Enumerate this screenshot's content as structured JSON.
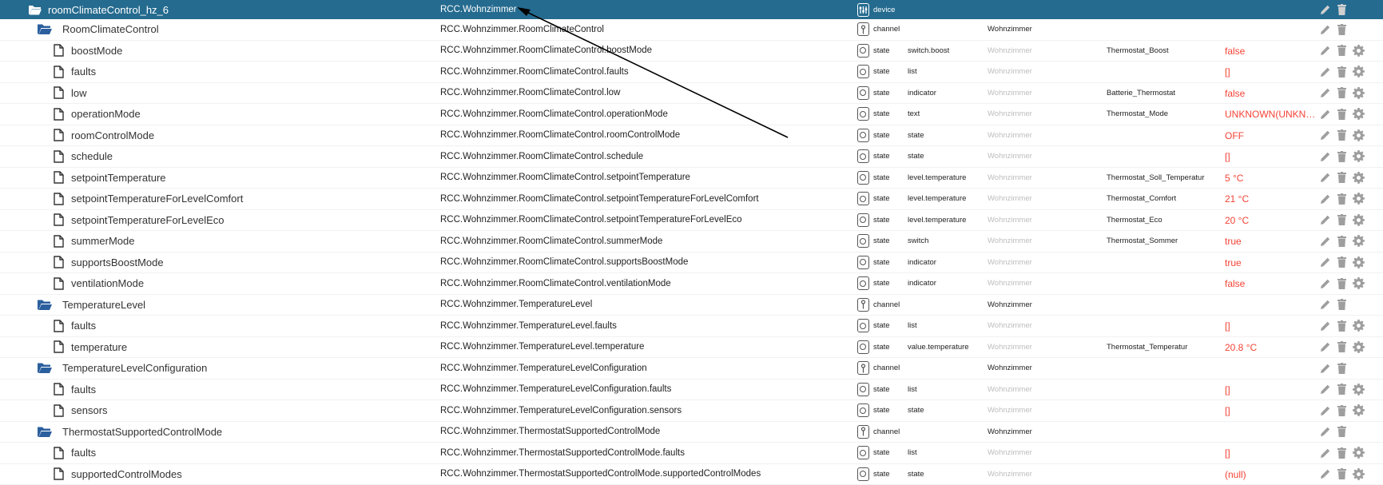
{
  "header": {
    "name": "roomClimateControl_hz_6",
    "id": "RCC.Wohnzimmer",
    "type": "device"
  },
  "rows": [
    {
      "kind": "channel",
      "name": "RoomClimateControl",
      "id": "RCC.Wohnzimmer.RoomClimateControl",
      "type": "channel",
      "role": "",
      "room": "Wohnzimmer",
      "func": "",
      "value": ""
    },
    {
      "kind": "state",
      "name": "boostMode",
      "id": "RCC.Wohnzimmer.RoomClimateControl.boostMode",
      "type": "state",
      "role": "switch.boost",
      "room": "Wohnzimmer",
      "func": "Thermostat_Boost",
      "value": "false"
    },
    {
      "kind": "state",
      "name": "faults",
      "id": "RCC.Wohnzimmer.RoomClimateControl.faults",
      "type": "state",
      "role": "list",
      "room": "Wohnzimmer",
      "func": "",
      "value": "[]"
    },
    {
      "kind": "state",
      "name": "low",
      "id": "RCC.Wohnzimmer.RoomClimateControl.low",
      "type": "state",
      "role": "indicator",
      "room": "Wohnzimmer",
      "func": "Batterie_Thermostat",
      "value": "false"
    },
    {
      "kind": "state",
      "name": "operationMode",
      "id": "RCC.Wohnzimmer.RoomClimateControl.operationMode",
      "type": "state",
      "role": "text",
      "room": "Wohnzimmer",
      "func": "Thermostat_Mode",
      "value": "UNKNOWN(UNKNOWN)"
    },
    {
      "kind": "state",
      "name": "roomControlMode",
      "id": "RCC.Wohnzimmer.RoomClimateControl.roomControlMode",
      "type": "state",
      "role": "state",
      "room": "Wohnzimmer",
      "func": "",
      "value": "OFF"
    },
    {
      "kind": "state",
      "name": "schedule",
      "id": "RCC.Wohnzimmer.RoomClimateControl.schedule",
      "type": "state",
      "role": "state",
      "room": "Wohnzimmer",
      "func": "",
      "value": "[]"
    },
    {
      "kind": "state",
      "name": "setpointTemperature",
      "id": "RCC.Wohnzimmer.RoomClimateControl.setpointTemperature",
      "type": "state",
      "role": "level.temperature",
      "room": "Wohnzimmer",
      "func": "Thermostat_Soll_Temperatur",
      "value": "5 °C"
    },
    {
      "kind": "state",
      "name": "setpointTemperatureForLevelComfort",
      "id": "RCC.Wohnzimmer.RoomClimateControl.setpointTemperatureForLevelComfort",
      "type": "state",
      "role": "level.temperature",
      "room": "Wohnzimmer",
      "func": "Thermostat_Comfort",
      "value": "21 °C"
    },
    {
      "kind": "state",
      "name": "setpointTemperatureForLevelEco",
      "id": "RCC.Wohnzimmer.RoomClimateControl.setpointTemperatureForLevelEco",
      "type": "state",
      "role": "level.temperature",
      "room": "Wohnzimmer",
      "func": "Thermostat_Eco",
      "value": "20 °C"
    },
    {
      "kind": "state",
      "name": "summerMode",
      "id": "RCC.Wohnzimmer.RoomClimateControl.summerMode",
      "type": "state",
      "role": "switch",
      "room": "Wohnzimmer",
      "func": "Thermostat_Sommer",
      "value": "true"
    },
    {
      "kind": "state",
      "name": "supportsBoostMode",
      "id": "RCC.Wohnzimmer.RoomClimateControl.supportsBoostMode",
      "type": "state",
      "role": "indicator",
      "room": "Wohnzimmer",
      "func": "",
      "value": "true"
    },
    {
      "kind": "state",
      "name": "ventilationMode",
      "id": "RCC.Wohnzimmer.RoomClimateControl.ventilationMode",
      "type": "state",
      "role": "indicator",
      "room": "Wohnzimmer",
      "func": "",
      "value": "false"
    },
    {
      "kind": "channel",
      "name": "TemperatureLevel",
      "id": "RCC.Wohnzimmer.TemperatureLevel",
      "type": "channel",
      "role": "",
      "room": "Wohnzimmer",
      "func": "",
      "value": ""
    },
    {
      "kind": "state",
      "name": "faults",
      "id": "RCC.Wohnzimmer.TemperatureLevel.faults",
      "type": "state",
      "role": "list",
      "room": "Wohnzimmer",
      "func": "",
      "value": "[]"
    },
    {
      "kind": "state",
      "name": "temperature",
      "id": "RCC.Wohnzimmer.TemperatureLevel.temperature",
      "type": "state",
      "role": "value.temperature",
      "room": "Wohnzimmer",
      "func": "Thermostat_Temperatur",
      "value": "20.8 °C"
    },
    {
      "kind": "channel",
      "name": "TemperatureLevelConfiguration",
      "id": "RCC.Wohnzimmer.TemperatureLevelConfiguration",
      "type": "channel",
      "role": "",
      "room": "Wohnzimmer",
      "func": "",
      "value": ""
    },
    {
      "kind": "state",
      "name": "faults",
      "id": "RCC.Wohnzimmer.TemperatureLevelConfiguration.faults",
      "type": "state",
      "role": "list",
      "room": "Wohnzimmer",
      "func": "",
      "value": "[]"
    },
    {
      "kind": "state",
      "name": "sensors",
      "id": "RCC.Wohnzimmer.TemperatureLevelConfiguration.sensors",
      "type": "state",
      "role": "state",
      "room": "Wohnzimmer",
      "func": "",
      "value": "[]"
    },
    {
      "kind": "channel",
      "name": "ThermostatSupportedControlMode",
      "id": "RCC.Wohnzimmer.ThermostatSupportedControlMode",
      "type": "channel",
      "role": "",
      "room": "Wohnzimmer",
      "func": "",
      "value": ""
    },
    {
      "kind": "state",
      "name": "faults",
      "id": "RCC.Wohnzimmer.ThermostatSupportedControlMode.faults",
      "type": "state",
      "role": "list",
      "room": "Wohnzimmer",
      "func": "",
      "value": "[]"
    },
    {
      "kind": "state",
      "name": "supportedControlModes",
      "id": "RCC.Wohnzimmer.ThermostatSupportedControlMode.supportedControlModes",
      "type": "state",
      "role": "state",
      "room": "Wohnzimmer",
      "func": "",
      "value": "(null)"
    }
  ],
  "icons": {
    "folder": "folder-open-icon",
    "file": "file-icon",
    "device": "device-sliders-icon",
    "channel": "channel-icon",
    "state": "state-icon",
    "edit": "pencil-icon",
    "delete": "trash-icon",
    "config": "gear-icon"
  },
  "colors": {
    "header_bg": "#256b8f",
    "value": "#f44336",
    "folder_icon": "#2b5f9e",
    "muted": "#bdbdbd"
  }
}
